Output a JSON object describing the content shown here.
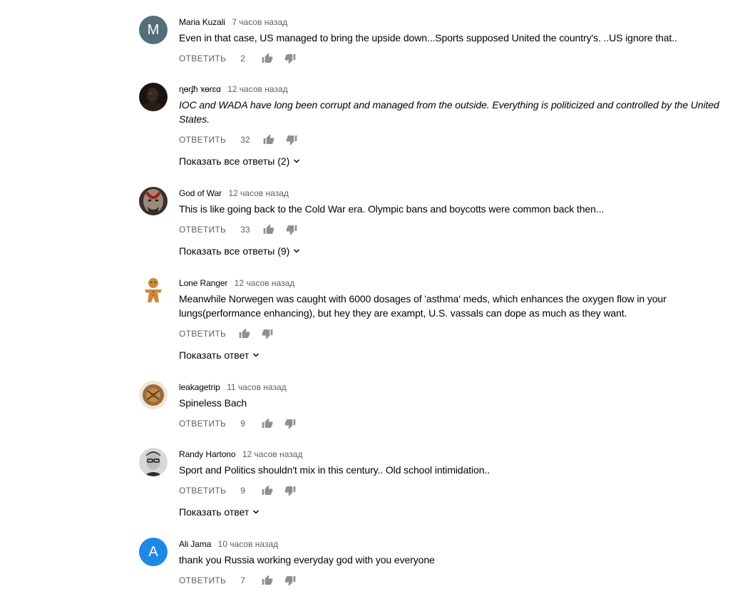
{
  "reply_label": "ОТВЕТИТЬ",
  "colors": {
    "text_primary": "#030303",
    "text_secondary": "#606060",
    "icon": "#909090"
  },
  "icons": {
    "like": "thumb-up-icon",
    "dislike": "thumb-down-icon",
    "expand": "chevron-down-icon"
  },
  "comments": [
    {
      "author": "Maria Kuzali",
      "time": "7 часов назад",
      "text": "Even in that case, US managed to bring the upside down...Sports supposed United the country's. ..US ignore that..",
      "likes": "2",
      "avatar_letter": "M",
      "avatar_color": "#546e7a"
    },
    {
      "author": "ɳɵɾʄɦ ҡɵɾɛɑ",
      "time": "12 часов назад",
      "text": "IOC and WADA have long been corrupt and managed from the outside. Everything is politicized and controlled by the United States.",
      "likes": "32",
      "replies": "Показать все ответы (2)"
    },
    {
      "author": "God of War",
      "time": "12 часов назад",
      "text": "This is like going back to the Cold War era. Olympic bans and boycotts were common back then...",
      "likes": "33",
      "replies": "Показать все ответы (9)"
    },
    {
      "author": "Lone Ranger",
      "time": "12 часов назад",
      "text": "Meanwhile Norwegen was caught with 6000 dosages of 'asthma' meds, which enhances the oxygen flow in your lungs(performance enhancing), but hey they are exampt, U.S. vassals can dope as much as they want.",
      "likes": "",
      "replies": "Показать ответ"
    },
    {
      "author": "leakagetrip",
      "time": "11 часов назад",
      "text": "Spineless Bach",
      "likes": "9"
    },
    {
      "author": "Randy Hartono",
      "time": "12 часов назад",
      "text": "Sport and Politics shouldn't mix in this century.. Old school intimidation..",
      "likes": "9",
      "replies": "Показать ответ"
    },
    {
      "author": "Ali Jama",
      "time": "10 часов назад",
      "text": "thank you Russia working everyday god with you everyone",
      "likes": "7",
      "avatar_letter": "A",
      "avatar_color": "#1e88e5"
    }
  ]
}
